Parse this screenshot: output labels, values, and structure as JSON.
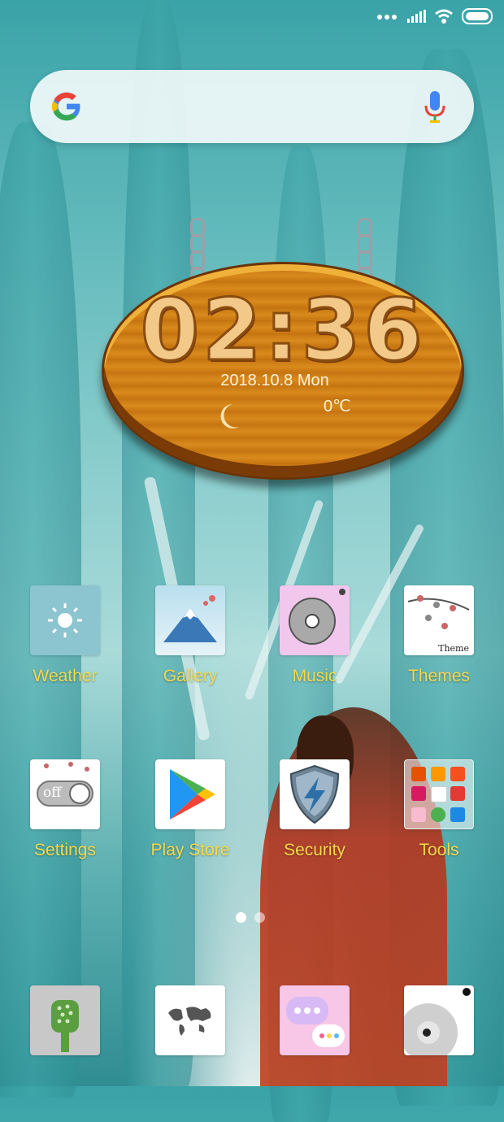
{
  "colors": {
    "label": "#f5d94a",
    "accent": "#2f8d92"
  },
  "search": {
    "left_icon": "google-g-icon",
    "right_icon": "microphone-icon"
  },
  "clock": {
    "time": "02:36",
    "date": "2018.10.8 Mon",
    "temperature": "0℃",
    "weather_icon": "moon-icon"
  },
  "apps": [
    {
      "label": "Weather",
      "icon": "weather-icon"
    },
    {
      "label": "Gallery",
      "icon": "gallery-icon"
    },
    {
      "label": "Music",
      "icon": "music-icon"
    },
    {
      "label": "Themes",
      "icon": "themes-icon",
      "badge": "Theme"
    },
    {
      "label": "Settings",
      "icon": "settings-icon",
      "toggle": "off"
    },
    {
      "label": "Play Store",
      "icon": "play-store-icon"
    },
    {
      "label": "Security",
      "icon": "security-icon"
    },
    {
      "label": "Tools",
      "icon": "tools-folder-icon"
    }
  ],
  "dock": [
    {
      "icon": "phone-dialer-icon"
    },
    {
      "icon": "browser-map-icon"
    },
    {
      "icon": "messages-icon"
    },
    {
      "icon": "camera-icon"
    }
  ],
  "pages": {
    "count": 2,
    "current": 1
  }
}
